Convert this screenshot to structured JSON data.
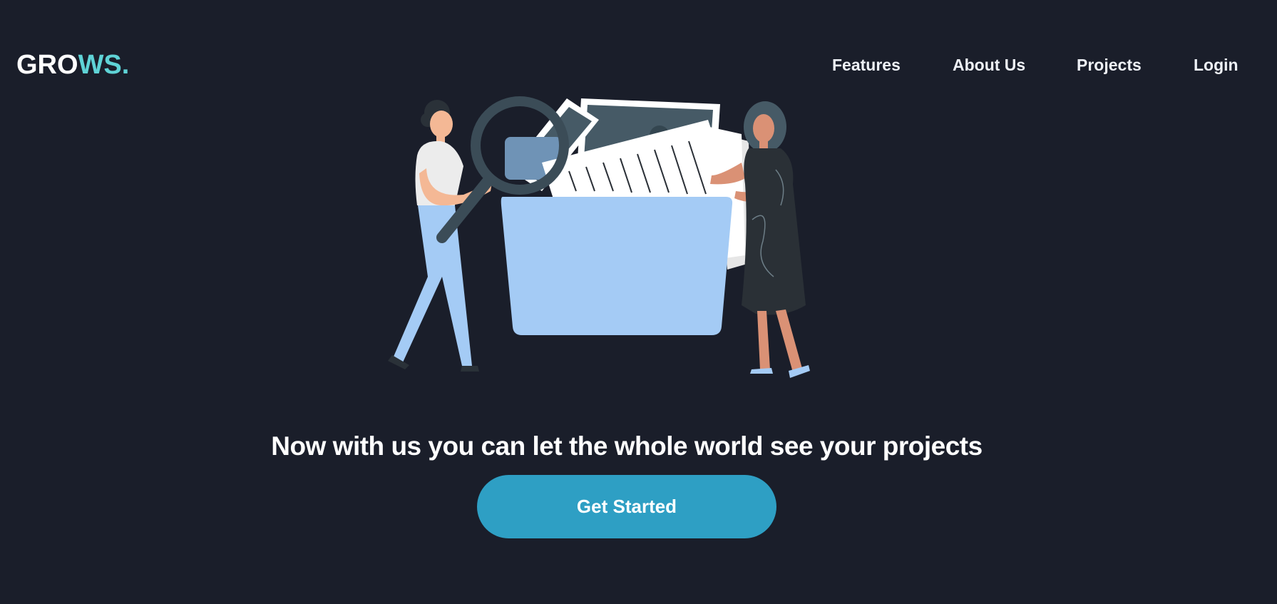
{
  "brand": {
    "logo_prefix": "GRO",
    "logo_accent": "WS.",
    "accent_color": "#5fd3d6"
  },
  "nav": {
    "items": [
      {
        "label": "Features"
      },
      {
        "label": "About Us"
      },
      {
        "label": "Projects"
      },
      {
        "label": "Login"
      }
    ]
  },
  "hero": {
    "headline": "Now with us you can let the whole world see your projects",
    "cta_label": "Get Started",
    "cta_color": "#2e9fc4",
    "illustration": "people-with-folder-and-magnifier-illustration"
  },
  "theme": {
    "background": "#1a1e2a",
    "text": "#ffffff"
  }
}
